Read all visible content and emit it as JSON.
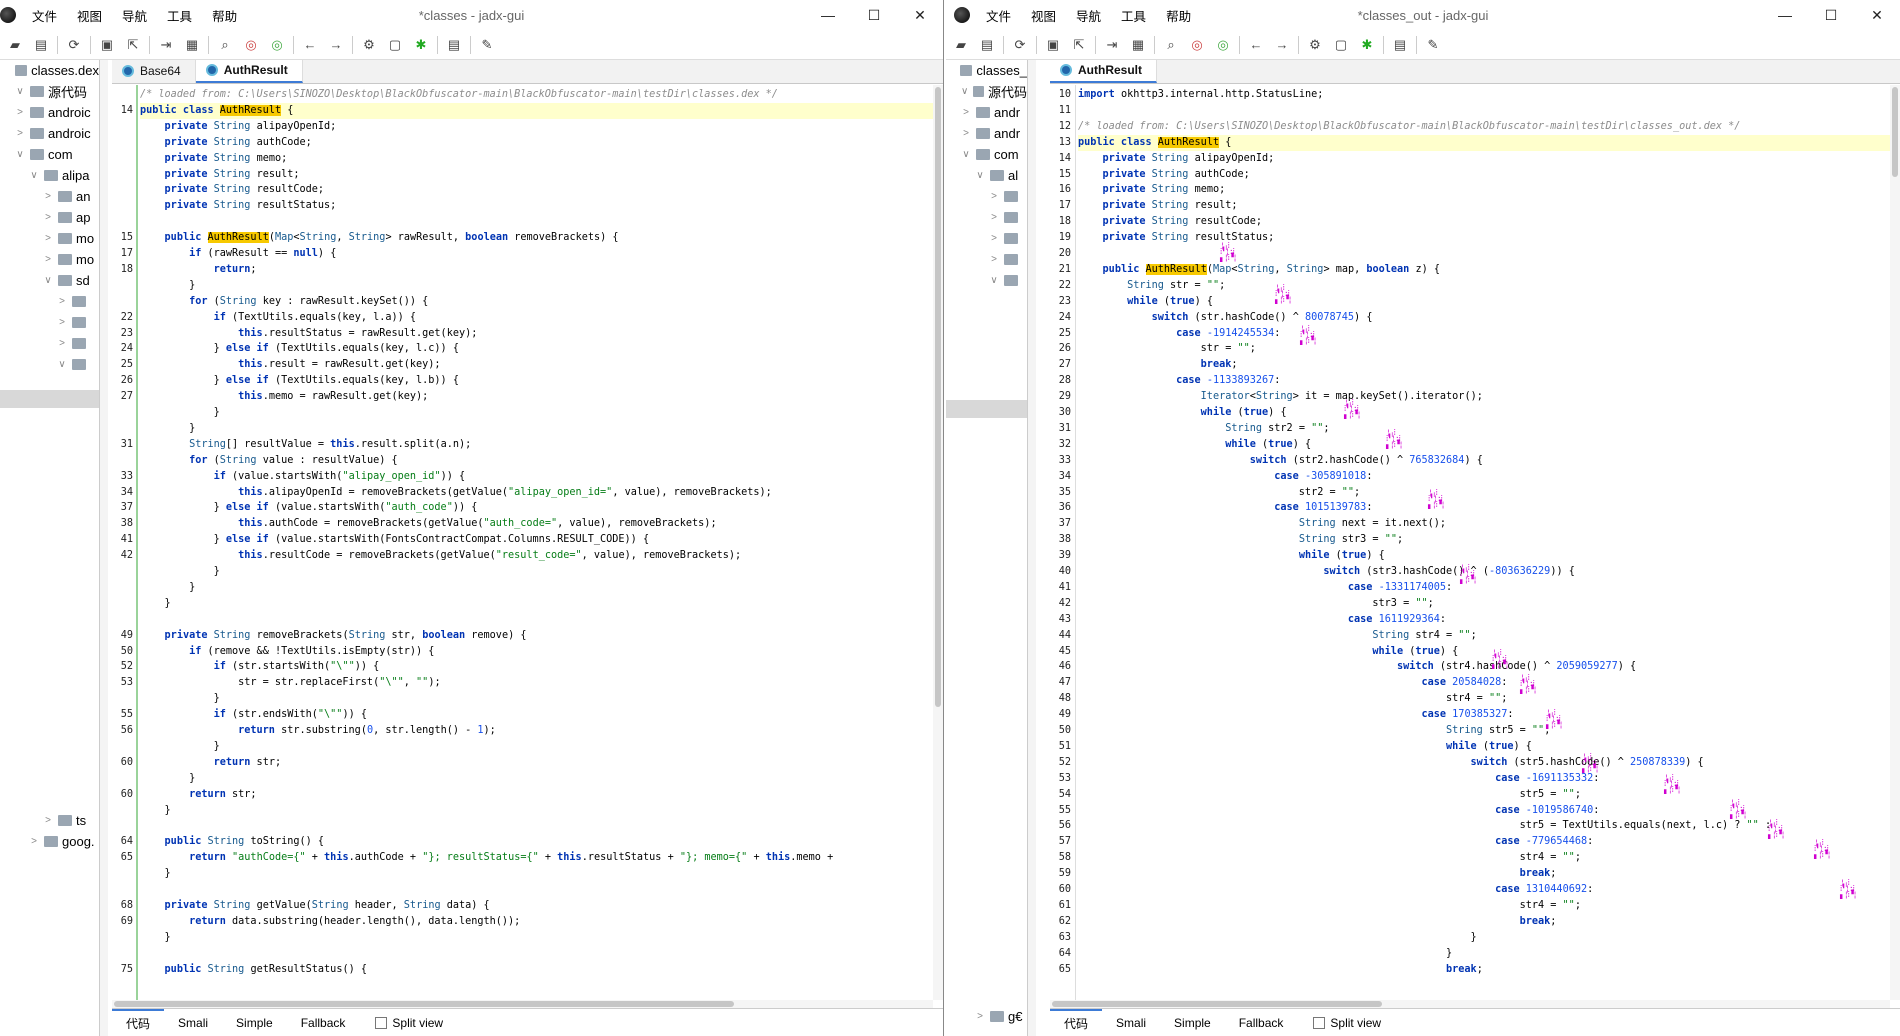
{
  "menu": [
    "文件",
    "视图",
    "导航",
    "工具",
    "帮助"
  ],
  "left": {
    "title": "*classes - jadx-gui",
    "tree": [
      {
        "label": "classes.dex",
        "indent": 0,
        "arrow": ""
      },
      {
        "label": "源代码",
        "indent": 1,
        "arrow": "∨"
      },
      {
        "label": "androic",
        "indent": 1,
        "arrow": ">"
      },
      {
        "label": "androic",
        "indent": 1,
        "arrow": ">"
      },
      {
        "label": "com",
        "indent": 1,
        "arrow": "∨"
      },
      {
        "label": "alipa",
        "indent": 2,
        "arrow": "∨"
      },
      {
        "label": "an",
        "indent": 3,
        "arrow": ">"
      },
      {
        "label": "ap",
        "indent": 3,
        "arrow": ">"
      },
      {
        "label": "mo",
        "indent": 3,
        "arrow": ">"
      },
      {
        "label": "mo",
        "indent": 3,
        "arrow": ">"
      },
      {
        "label": "sd",
        "indent": 3,
        "arrow": "∨"
      },
      {
        "label": "",
        "indent": 4,
        "arrow": ">"
      },
      {
        "label": "",
        "indent": 4,
        "arrow": ">"
      },
      {
        "label": "",
        "indent": 4,
        "arrow": ">"
      },
      {
        "label": "",
        "indent": 4,
        "arrow": "∨"
      }
    ],
    "tree_bottom": [
      {
        "label": "ts",
        "indent": 3,
        "arrow": ">"
      },
      {
        "label": "goog.",
        "indent": 2,
        "arrow": ">"
      }
    ],
    "tabs": [
      "Base64",
      "AuthResult"
    ],
    "bottom_tabs": [
      "代码",
      "Smali",
      "Simple",
      "Fallback"
    ],
    "split_view": "Split view",
    "code": [
      {
        "n": "",
        "t": "<span class='cm'>/* loaded from: C:\\Users\\SINOZO\\Desktop\\BlackObfuscator-main\\BlackObfuscator-main\\testDir\\classes.dex */</span>"
      },
      {
        "n": "14",
        "t": "<span class='kw'>public class</span> <span class='hl'>AuthResult</span> {",
        "cur": true
      },
      {
        "n": "",
        "t": "    <span class='kw'>private</span> <span class='ty'>String</span> alipayOpenId;"
      },
      {
        "n": "",
        "t": "    <span class='kw'>private</span> <span class='ty'>String</span> authCode;"
      },
      {
        "n": "",
        "t": "    <span class='kw'>private</span> <span class='ty'>String</span> memo;"
      },
      {
        "n": "",
        "t": "    <span class='kw'>private</span> <span class='ty'>String</span> result;"
      },
      {
        "n": "",
        "t": "    <span class='kw'>private</span> <span class='ty'>String</span> resultCode;"
      },
      {
        "n": "",
        "t": "    <span class='kw'>private</span> <span class='ty'>String</span> resultStatus;"
      },
      {
        "n": "",
        "t": ""
      },
      {
        "n": "15",
        "t": "    <span class='kw'>public</span> <span class='hl'>AuthResult</span>(<span class='ty'>Map</span>&lt;<span class='ty'>String</span>, <span class='ty'>String</span>&gt; rawResult, <span class='kw'>boolean</span> removeBrackets) {"
      },
      {
        "n": "17",
        "t": "        <span class='kw'>if</span> (rawResult == <span class='kw'>null</span>) {"
      },
      {
        "n": "18",
        "t": "            <span class='kw'>return</span>;"
      },
      {
        "n": "",
        "t": "        }"
      },
      {
        "n": "",
        "t": "        <span class='kw'>for</span> (<span class='ty'>String</span> key : rawResult.keySet()) {"
      },
      {
        "n": "22",
        "t": "            <span class='kw'>if</span> (TextUtils.equals(key, l.a)) {"
      },
      {
        "n": "23",
        "t": "                <span class='kw'>this</span>.resultStatus = rawResult.get(key);"
      },
      {
        "n": "24",
        "t": "            } <span class='kw'>else if</span> (TextUtils.equals(key, l.c)) {"
      },
      {
        "n": "25",
        "t": "                <span class='kw'>this</span>.result = rawResult.get(key);"
      },
      {
        "n": "26",
        "t": "            } <span class='kw'>else if</span> (TextUtils.equals(key, l.b)) {"
      },
      {
        "n": "27",
        "t": "                <span class='kw'>this</span>.memo = rawResult.get(key);"
      },
      {
        "n": "",
        "t": "            }"
      },
      {
        "n": "",
        "t": "        }"
      },
      {
        "n": "31",
        "t": "        <span class='ty'>String</span>[] resultValue = <span class='kw'>this</span>.result.split(a.n);"
      },
      {
        "n": "",
        "t": "        <span class='kw'>for</span> (<span class='ty'>String</span> value : resultValue) {"
      },
      {
        "n": "33",
        "t": "            <span class='kw'>if</span> (value.startsWith(<span class='str'>\"alipay_open_id\"</span>)) {"
      },
      {
        "n": "34",
        "t": "                <span class='kw'>this</span>.alipayOpenId = removeBrackets(getValue(<span class='str'>\"alipay_open_id=\"</span>, value), removeBrackets);"
      },
      {
        "n": "37",
        "t": "            } <span class='kw'>else if</span> (value.startsWith(<span class='str'>\"auth_code\"</span>)) {"
      },
      {
        "n": "38",
        "t": "                <span class='kw'>this</span>.authCode = removeBrackets(getValue(<span class='str'>\"auth_code=\"</span>, value), removeBrackets);"
      },
      {
        "n": "41",
        "t": "            } <span class='kw'>else if</span> (value.startsWith(FontsContractCompat.Columns.RESULT_CODE)) {"
      },
      {
        "n": "42",
        "t": "                <span class='kw'>this</span>.resultCode = removeBrackets(getValue(<span class='str'>\"result_code=\"</span>, value), removeBrackets);"
      },
      {
        "n": "",
        "t": "            }"
      },
      {
        "n": "",
        "t": "        }"
      },
      {
        "n": "",
        "t": "    }"
      },
      {
        "n": "",
        "t": ""
      },
      {
        "n": "49",
        "t": "    <span class='kw'>private</span> <span class='ty'>String</span> removeBrackets(<span class='ty'>String</span> str, <span class='kw'>boolean</span> remove) {"
      },
      {
        "n": "50",
        "t": "        <span class='kw'>if</span> (remove &amp;&amp; !TextUtils.isEmpty(str)) {"
      },
      {
        "n": "52",
        "t": "            <span class='kw'>if</span> (str.startsWith(<span class='str'>\"\\\"\"</span>)) {"
      },
      {
        "n": "53",
        "t": "                str = str.replaceFirst(<span class='str'>\"\\\"\"</span>, <span class='str'>\"\"</span>);"
      },
      {
        "n": "",
        "t": "            }"
      },
      {
        "n": "55",
        "t": "            <span class='kw'>if</span> (str.endsWith(<span class='str'>\"\\\"\"</span>)) {"
      },
      {
        "n": "56",
        "t": "                <span class='kw'>return</span> str.substring(<span class='num'>0</span>, str.length() - <span class='num'>1</span>);"
      },
      {
        "n": "",
        "t": "            }"
      },
      {
        "n": "60",
        "t": "            <span class='kw'>return</span> str;"
      },
      {
        "n": "",
        "t": "        }"
      },
      {
        "n": "60",
        "t": "        <span class='kw'>return</span> str;"
      },
      {
        "n": "",
        "t": "    }"
      },
      {
        "n": "",
        "t": ""
      },
      {
        "n": "64",
        "t": "    <span class='kw'>public</span> <span class='ty'>String</span> toString() {"
      },
      {
        "n": "65",
        "t": "        <span class='kw'>return</span> <span class='str'>\"authCode={\"</span> + <span class='kw'>this</span>.authCode + <span class='str'>\"}; resultStatus={\"</span> + <span class='kw'>this</span>.resultStatus + <span class='str'>\"}; memo={\"</span> + <span class='kw'>this</span>.memo +"
      },
      {
        "n": "",
        "t": "    }"
      },
      {
        "n": "",
        "t": ""
      },
      {
        "n": "68",
        "t": "    <span class='kw'>private</span> <span class='ty'>String</span> getValue(<span class='ty'>String</span> header, <span class='ty'>String</span> data) {"
      },
      {
        "n": "69",
        "t": "        <span class='kw'>return</span> data.substring(header.length(), data.length());"
      },
      {
        "n": "",
        "t": "    }"
      },
      {
        "n": "",
        "t": ""
      },
      {
        "n": "75",
        "t": "    <span class='kw'>public</span> <span class='ty'>String</span> getResultStatus() {"
      }
    ]
  },
  "right": {
    "title": "*classes_out - jadx-gui",
    "tree": [
      {
        "label": "classes_",
        "indent": 0,
        "arrow": ""
      },
      {
        "label": "源代码",
        "indent": 1,
        "arrow": "∨"
      },
      {
        "label": "andr",
        "indent": 1,
        "arrow": ">"
      },
      {
        "label": "andr",
        "indent": 1,
        "arrow": ">"
      },
      {
        "label": "com",
        "indent": 1,
        "arrow": "∨"
      },
      {
        "label": "al",
        "indent": 2,
        "arrow": "∨"
      },
      {
        "label": "",
        "indent": 3,
        "arrow": ">"
      },
      {
        "label": "",
        "indent": 3,
        "arrow": ">"
      },
      {
        "label": "",
        "indent": 3,
        "arrow": ">"
      },
      {
        "label": "",
        "indent": 3,
        "arrow": ">"
      },
      {
        "label": "",
        "indent": 3,
        "arrow": "∨"
      }
    ],
    "tree_bottom": [
      {
        "label": "g€",
        "indent": 2,
        "arrow": ">"
      }
    ],
    "tabs": [
      "AuthResult"
    ],
    "bottom_tabs": [
      "代码",
      "Smali",
      "Simple",
      "Fallback"
    ],
    "split_view": "Split view",
    "code": [
      {
        "n": "10",
        "t": "<span class='kw'>import</span> okhttp3.internal.http.StatusLine;"
      },
      {
        "n": "11",
        "t": ""
      },
      {
        "n": "12",
        "t": "<span class='cm'>/* loaded from: C:\\Users\\SINOZO\\Desktop\\BlackObfuscator-main\\BlackObfuscator-main\\testDir\\classes_out.dex */</span>"
      },
      {
        "n": "13",
        "t": "<span class='kw'>public class</span> <span class='hl'>AuthResult</span> {",
        "cur": true
      },
      {
        "n": "14",
        "t": "    <span class='kw'>private</span> <span class='ty'>String</span> alipayOpenId;"
      },
      {
        "n": "15",
        "t": "    <span class='kw'>private</span> <span class='ty'>String</span> authCode;"
      },
      {
        "n": "16",
        "t": "    <span class='kw'>private</span> <span class='ty'>String</span> memo;"
      },
      {
        "n": "17",
        "t": "    <span class='kw'>private</span> <span class='ty'>String</span> result;"
      },
      {
        "n": "18",
        "t": "    <span class='kw'>private</span> <span class='ty'>String</span> resultCode;"
      },
      {
        "n": "19",
        "t": "    <span class='kw'>private</span> <span class='ty'>String</span> resultStatus;"
      },
      {
        "n": "20",
        "t": ""
      },
      {
        "n": "21",
        "t": "    <span class='kw'>public</span> <span class='hl'>AuthResult</span>(<span class='ty'>Map</span>&lt;<span class='ty'>String</span>, <span class='ty'>String</span>&gt; map, <span class='kw'>boolean</span> z) {"
      },
      {
        "n": "22",
        "t": "        <span class='ty'>String</span> str = <span class='str'>\"\"</span>;"
      },
      {
        "n": "23",
        "t": "        <span class='kw'>while</span> (<span class='kw'>true</span>) {"
      },
      {
        "n": "24",
        "t": "            <span class='kw'>switch</span> (str.hashCode() ^ <span class='num'>80078745</span>) {"
      },
      {
        "n": "25",
        "t": "                <span class='kw'>case</span> <span class='num'>-1914245534</span>:"
      },
      {
        "n": "26",
        "t": "                    str = <span class='str'>\"\"</span>;"
      },
      {
        "n": "27",
        "t": "                    <span class='kw'>break</span>;"
      },
      {
        "n": "28",
        "t": "                <span class='kw'>case</span> <span class='num'>-1133893267</span>:"
      },
      {
        "n": "29",
        "t": "                    <span class='ty'>Iterator</span>&lt;<span class='ty'>String</span>&gt; it = map.keySet().iterator();"
      },
      {
        "n": "30",
        "t": "                    <span class='kw'>while</span> (<span class='kw'>true</span>) {"
      },
      {
        "n": "31",
        "t": "                        <span class='ty'>String</span> str2 = <span class='str'>\"\"</span>;"
      },
      {
        "n": "32",
        "t": "                        <span class='kw'>while</span> (<span class='kw'>true</span>) {"
      },
      {
        "n": "33",
        "t": "                            <span class='kw'>switch</span> (str2.hashCode() ^ <span class='num'>765832684</span>) {"
      },
      {
        "n": "34",
        "t": "                                <span class='kw'>case</span> <span class='num'>-305891018</span>:"
      },
      {
        "n": "35",
        "t": "                                    str2 = <span class='str'>\"\"</span>;"
      },
      {
        "n": "36",
        "t": "                                <span class='kw'>case</span> <span class='num'>1015139783</span>:"
      },
      {
        "n": "37",
        "t": "                                    <span class='ty'>String</span> next = it.next();"
      },
      {
        "n": "38",
        "t": "                                    <span class='ty'>String</span> str3 = <span class='str'>\"\"</span>;"
      },
      {
        "n": "39",
        "t": "                                    <span class='kw'>while</span> (<span class='kw'>true</span>) {"
      },
      {
        "n": "40",
        "t": "                                        <span class='kw'>switch</span> (str3.hashCode() ^ (<span class='num'>-803636229</span>)) {"
      },
      {
        "n": "41",
        "t": "                                            <span class='kw'>case</span> <span class='num'>-1331174005</span>:"
      },
      {
        "n": "42",
        "t": "                                                str3 = <span class='str'>\"\"</span>;"
      },
      {
        "n": "43",
        "t": "                                            <span class='kw'>case</span> <span class='num'>1611929364</span>:"
      },
      {
        "n": "44",
        "t": "                                                <span class='ty'>String</span> str4 = <span class='str'>\"\"</span>;"
      },
      {
        "n": "45",
        "t": "                                                <span class='kw'>while</span> (<span class='kw'>true</span>) {"
      },
      {
        "n": "46",
        "t": "                                                    <span class='kw'>switch</span> (str4.hashCode() ^ <span class='num'>2059059277</span>) {"
      },
      {
        "n": "47",
        "t": "                                                        <span class='kw'>case</span> <span class='num'>20584028</span>:"
      },
      {
        "n": "48",
        "t": "                                                            str4 = <span class='str'>\"\"</span>;"
      },
      {
        "n": "49",
        "t": "                                                        <span class='kw'>case</span> <span class='num'>170385327</span>:"
      },
      {
        "n": "50",
        "t": "                                                            <span class='ty'>String</span> str5 = <span class='str'>\"\"</span>;"
      },
      {
        "n": "51",
        "t": "                                                            <span class='kw'>while</span> (<span class='kw'>true</span>) {"
      },
      {
        "n": "52",
        "t": "                                                                <span class='kw'>switch</span> (str5.hashCode() ^ <span class='num'>250878339</span>) {"
      },
      {
        "n": "53",
        "t": "                                                                    <span class='kw'>case</span> <span class='num'>-1691135332</span>:"
      },
      {
        "n": "54",
        "t": "                                                                        str5 = <span class='str'>\"\"</span>;"
      },
      {
        "n": "55",
        "t": "                                                                    <span class='kw'>case</span> <span class='num'>-1019586740</span>:"
      },
      {
        "n": "56",
        "t": "                                                                        str5 = TextUtils.equals(next, l.c) ? <span class='str'>\"\"</span> :"
      },
      {
        "n": "57",
        "t": "                                                                    <span class='kw'>case</span> <span class='num'>-779654468</span>:"
      },
      {
        "n": "58",
        "t": "                                                                        str4 = <span class='str'>\"\"</span>;"
      },
      {
        "n": "59",
        "t": "                                                                        <span class='kw'>break</span>;"
      },
      {
        "n": "60",
        "t": "                                                                    <span class='kw'>case</span> <span class='num'>1310440692</span>:"
      },
      {
        "n": "61",
        "t": "                                                                        str4 = <span class='str'>\"\"</span>;"
      },
      {
        "n": "62",
        "t": "                                                                        <span class='kw'>break</span>;"
      },
      {
        "n": "63",
        "t": "                                                                }"
      },
      {
        "n": "64",
        "t": "                                                            }"
      },
      {
        "n": "65",
        "t": "                                                            <span class='kw'>break</span>;"
      }
    ]
  }
}
